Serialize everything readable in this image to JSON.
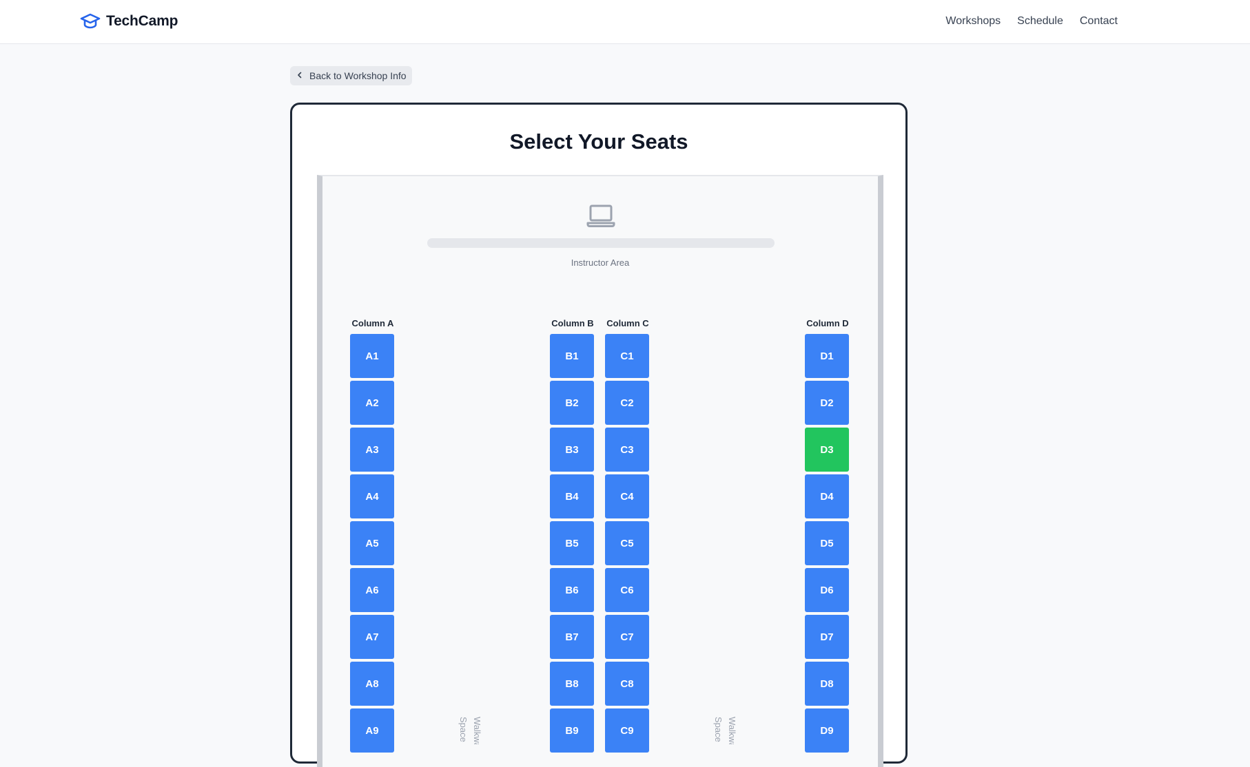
{
  "brand": {
    "name": "TechCamp",
    "icon": "graduation-cap-icon",
    "color": "#2563eb"
  },
  "nav": [
    {
      "label": "Workshops"
    },
    {
      "label": "Schedule"
    },
    {
      "label": "Contact"
    }
  ],
  "back": {
    "label": "Back to Workshop Info",
    "icon": "chevron-left-icon"
  },
  "page": {
    "title": "Select Your Seats"
  },
  "room": {
    "instructor_icon": "laptop-icon",
    "instructor_label": "Instructor Area",
    "walkway_label": "Walkway Space",
    "columns": [
      {
        "label": "Column A",
        "seats": [
          "A1",
          "A2",
          "A3",
          "A4",
          "A5",
          "A6",
          "A7",
          "A8",
          "A9"
        ]
      },
      {
        "label": "Column B",
        "seats": [
          "B1",
          "B2",
          "B3",
          "B4",
          "B5",
          "B6",
          "B7",
          "B8",
          "B9"
        ]
      },
      {
        "label": "Column C",
        "seats": [
          "C1",
          "C2",
          "C3",
          "C4",
          "C5",
          "C6",
          "C7",
          "C8",
          "C9"
        ]
      },
      {
        "label": "Column D",
        "seats": [
          "D1",
          "D2",
          "D3",
          "D4",
          "D5",
          "D6",
          "D7",
          "D8",
          "D9"
        ]
      }
    ],
    "selected_seats": [
      "D3"
    ]
  },
  "colors": {
    "seat_available": "#3b82f6",
    "seat_selected": "#22c55e"
  }
}
